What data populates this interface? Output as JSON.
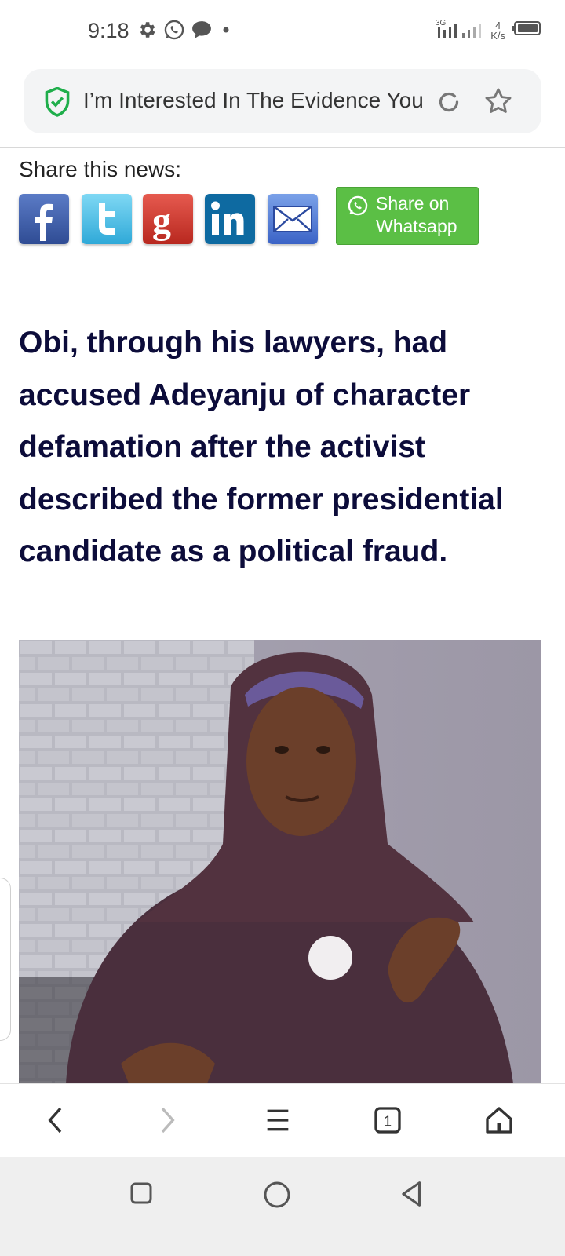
{
  "status_bar": {
    "time": "9:18",
    "icons": [
      "gear-icon",
      "whatsapp-icon",
      "chat-bubble-icon",
      "dot-icon"
    ],
    "network": "3G",
    "speed_value": "4",
    "speed_unit": "K/s",
    "right_icons": [
      "signal-icon",
      "battery-icon"
    ]
  },
  "url_bar": {
    "title": "I’m Interested In The Evidence You",
    "icons": [
      "shield-check-icon",
      "reload-icon",
      "star-icon"
    ]
  },
  "share": {
    "label": "Share this news:",
    "buttons": [
      "facebook",
      "twitter",
      "google-plus",
      "linkedin",
      "email"
    ],
    "whatsapp_line1": "Share on",
    "whatsapp_line2": "Whatsapp",
    "colors": {
      "whatsapp": "#5bbf45",
      "facebook": "#3b5998",
      "twitter": "#4fc3e8",
      "google": "#d63b2f",
      "linkedin": "#0e6aa1"
    }
  },
  "article": {
    "headline": "Obi, through his lawyers, had accused Adeyanju of character defamation after the activist described the former presidential candidate as a political fraud.",
    "headline_color": "#0c0c3a"
  },
  "toolbar": {
    "icons": [
      "back-icon",
      "forward-icon",
      "menu-icon",
      "tabs-icon",
      "home-icon"
    ],
    "tab_count": "1"
  },
  "system_nav": {
    "icons": [
      "recents-icon",
      "home-circle-icon",
      "back-triangle-icon"
    ]
  }
}
